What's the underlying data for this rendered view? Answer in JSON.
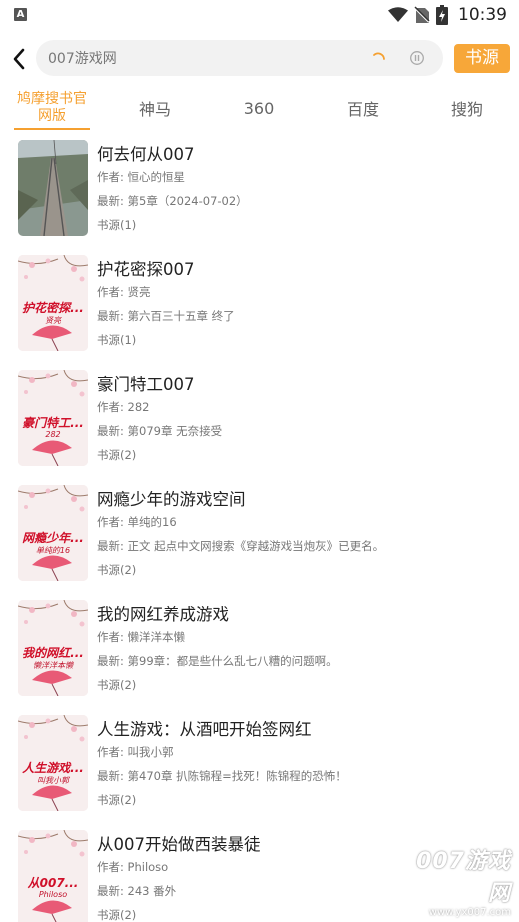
{
  "status_bar": {
    "app_icon_letter": "A",
    "time": "10:39"
  },
  "search": {
    "value": "007游戏网",
    "source_button": "书源"
  },
  "tabs": [
    {
      "label": "鸠摩搜书官网版",
      "active": true
    },
    {
      "label": "神马",
      "active": false
    },
    {
      "label": "360",
      "active": false
    },
    {
      "label": "百度",
      "active": false
    },
    {
      "label": "搜狗",
      "active": false
    }
  ],
  "books": [
    {
      "title": "何去何从007",
      "author": "作者: 恒心的恒星",
      "latest": "最新: 第5章（2024-07-02）",
      "source": "书源(1)",
      "cover_title": "",
      "cover_author": "",
      "cover_type": "photo"
    },
    {
      "title": "护花密探007",
      "author": "作者: 贤亮",
      "latest": "最新: 第六百三十五章 终了",
      "source": "书源(1)",
      "cover_title": "护花密探...",
      "cover_author": "贤亮",
      "cover_type": "default"
    },
    {
      "title": "豪门特工007",
      "author": "作者: 282",
      "latest": "最新: 第079章 无奈接受",
      "source": "书源(2)",
      "cover_title": "豪门特工...",
      "cover_author": "282",
      "cover_type": "default"
    },
    {
      "title": "网瘾少年的游戏空间",
      "author": "作者: 单纯的16",
      "latest": "最新: 正文 起点中文网搜索《穿越游戏当炮灰》已更名。",
      "source": "书源(2)",
      "cover_title": "网瘾少年...",
      "cover_author": "单纯的16",
      "cover_type": "default"
    },
    {
      "title": "我的网红养成游戏",
      "author": "作者: 懒洋洋本懒",
      "latest": "最新: 第99章：都是些什么乱七八糟的问题啊。",
      "source": "书源(2)",
      "cover_title": "我的网红...",
      "cover_author": "懒洋洋本懒",
      "cover_type": "default"
    },
    {
      "title": "人生游戏：从酒吧开始签网红",
      "author": "作者: 叫我小郭",
      "latest": "最新: 第470章 扒陈锦程=找死！陈锦程的恐怖！",
      "source": "书源(2)",
      "cover_title": "人生游戏...",
      "cover_author": "叫我小郭",
      "cover_type": "default"
    },
    {
      "title": "从007开始做西装暴徒",
      "author": "作者: Philoso",
      "latest": "最新: 243 番外",
      "source": "书源(2)",
      "cover_title": "从007...",
      "cover_author": "Philoso",
      "cover_type": "default"
    }
  ],
  "watermark": {
    "logo": "007游戏网",
    "url": "www.yx007.com"
  },
  "colors": {
    "accent": "#f5a030",
    "cover_red": "#d0102a"
  }
}
